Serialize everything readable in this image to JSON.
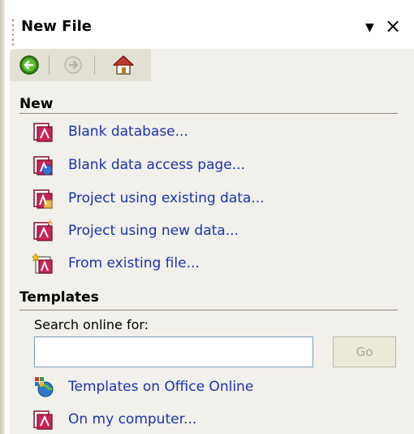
{
  "panel": {
    "title": "New File"
  },
  "nav": {
    "back_icon": "back-arrow-icon",
    "forward_icon": "forward-arrow-icon",
    "home_icon": "home-icon"
  },
  "sections": {
    "new": {
      "heading": "New",
      "items": [
        {
          "label": "Blank database...",
          "icon": "database-file-icon"
        },
        {
          "label": "Blank data access page...",
          "icon": "data-access-page-icon"
        },
        {
          "label": "Project using existing data...",
          "icon": "project-existing-icon"
        },
        {
          "label": "Project using new data...",
          "icon": "project-new-icon"
        },
        {
          "label": "From existing file...",
          "icon": "existing-file-icon"
        }
      ]
    },
    "templates": {
      "heading": "Templates",
      "search_label": "Search online for:",
      "search_value": "",
      "go_label": "Go",
      "items": [
        {
          "label": "Templates on Office Online",
          "icon": "office-online-icon"
        },
        {
          "label": "On my computer...",
          "icon": "computer-templates-icon"
        }
      ]
    }
  },
  "colors": {
    "link": "#1a33b0",
    "pane_bg": "#f1f0ea",
    "nav_bg": "#e3e1d6"
  }
}
